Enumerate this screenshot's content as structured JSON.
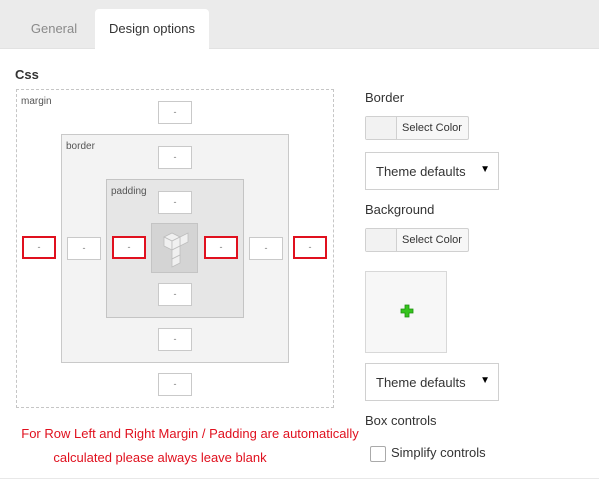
{
  "tabs": [
    {
      "label": "General",
      "active": false
    },
    {
      "label": "Design options",
      "active": true
    }
  ],
  "css_section": {
    "title": "Css",
    "margin_label": "margin",
    "border_label": "border",
    "padding_label": "padding",
    "margin": {
      "top": "-",
      "bottom": "-",
      "left": "-",
      "right": "-"
    },
    "border": {
      "top": "-",
      "bottom": "-",
      "left": "-",
      "right": "-"
    },
    "padding": {
      "top": "-",
      "bottom": "-",
      "left": "-",
      "right": "-"
    },
    "highlight_color": "#e0101e"
  },
  "notice": {
    "line1": "For Row Left and Right Margin / Padding are automatically",
    "line2": "calculated please always leave blank",
    "color": "#e0101e"
  },
  "right_panel": {
    "border_label": "Border",
    "border_color_button": "Select Color",
    "border_style_select": "Theme defaults",
    "background_label": "Background",
    "background_color_button": "Select Color",
    "background_image_icon": "plus-icon",
    "background_style_select": "Theme defaults",
    "box_controls_label": "Box controls",
    "simplify_controls_label": "Simplify controls",
    "simplify_controls_checked": false,
    "select_arrow": "▼"
  }
}
